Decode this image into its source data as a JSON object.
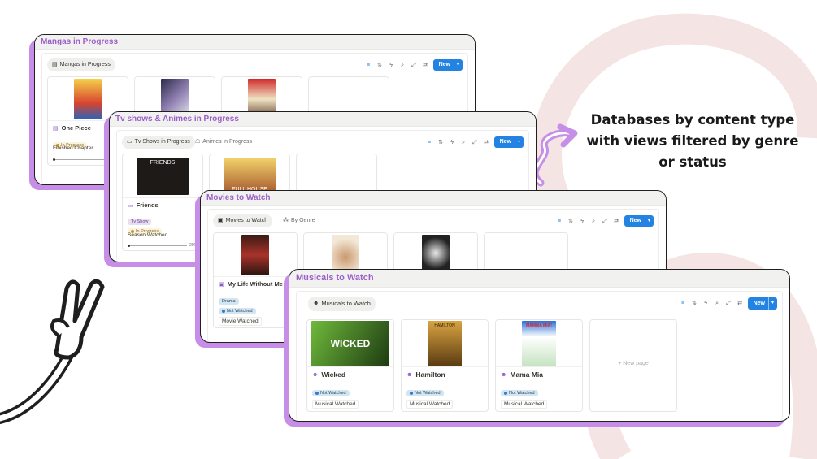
{
  "headline": "Databases by content type with views filtered by genre or status",
  "colors": {
    "accent_purple": "#c68ee6",
    "blue": "#2383e2",
    "swirl": "#f3e2e2"
  },
  "panels": {
    "mangas": {
      "title": "Mangas in Progress",
      "tabs": [
        {
          "label": "Mangas in Progress",
          "icon": "book-icon"
        }
      ],
      "new_label": "New",
      "card": {
        "name": "One Piece",
        "status": "In Progress",
        "prop": "Finished Chapter",
        "progress": "5%"
      }
    },
    "tv": {
      "title": "Tv shows & Animes in Progress",
      "tabs": [
        {
          "label": "Tv Shows in Progress",
          "icon": "tv-icon"
        },
        {
          "label": "Animes in Progress",
          "icon": "robot-icon"
        }
      ],
      "new_label": "New",
      "card": {
        "name": "Friends",
        "genre": "Tv Show",
        "status": "In Progress",
        "prop": "Season Watched",
        "progress": "20%"
      },
      "posters": [
        "FRIENDS",
        "FULL HOUSE"
      ]
    },
    "movies": {
      "title": "Movies to Watch",
      "tabs": [
        {
          "label": "Movies to Watch",
          "icon": "film-icon"
        },
        {
          "label": "By Genre",
          "icon": "group-icon"
        }
      ],
      "new_label": "New",
      "card": {
        "name": "My Life Without Me",
        "genre": "Drama",
        "status": "Not Watched",
        "prop": "Movie Watched"
      }
    },
    "musicals": {
      "title": "Musicals to Watch",
      "tabs": [
        {
          "label": "Musicals to Watch",
          "icon": "mask-icon"
        }
      ],
      "new_label": "New",
      "cards": [
        {
          "name": "Wicked",
          "status": "Not Watched",
          "prop": "Musical Watched",
          "poster_text": "WICKED"
        },
        {
          "name": "Hamilton",
          "status": "Not Watched",
          "prop": "Musical Watched",
          "poster_text": "HAMILTON"
        },
        {
          "name": "Mama Mia",
          "status": "Not Watched",
          "prop": "Musical Watched",
          "poster_text": "MAMMA MIA!"
        }
      ],
      "new_page": "New page"
    }
  }
}
